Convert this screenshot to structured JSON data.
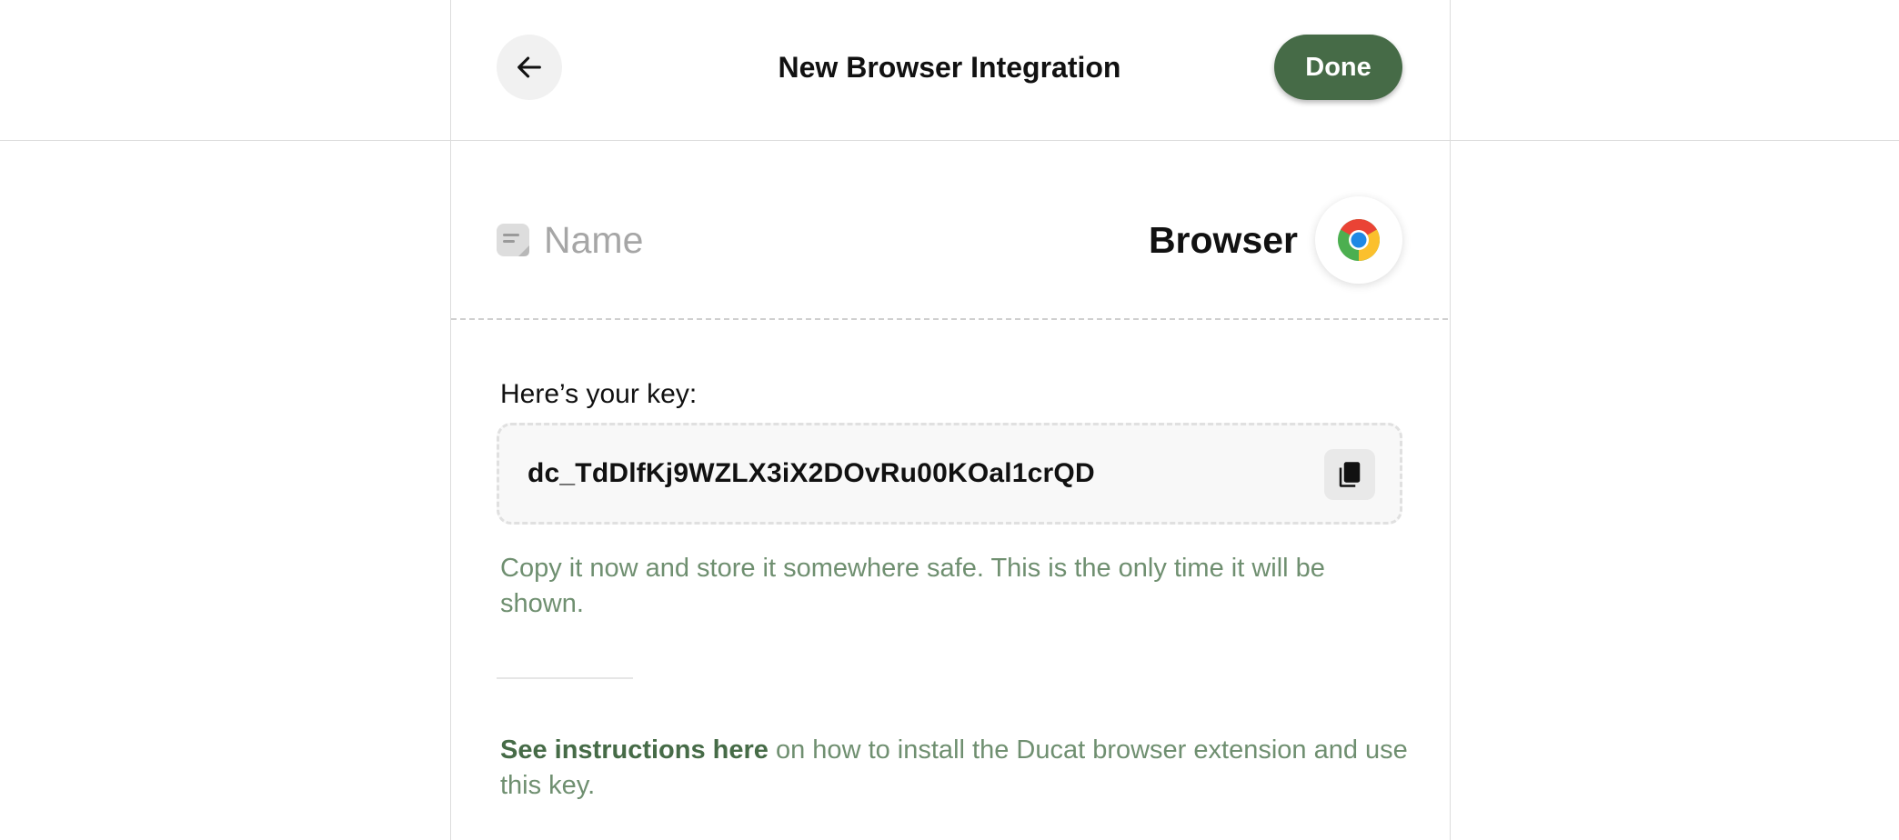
{
  "header": {
    "title": "New Browser Integration",
    "done_label": "Done",
    "back_icon": "arrow-left-icon"
  },
  "integration": {
    "name_placeholder": "Name",
    "name_value": "",
    "name_icon": "note-icon",
    "type_label": "Browser",
    "type_icon": "chrome-icon"
  },
  "key_section": {
    "label": "Here’s your key:",
    "key_value": "dc_TdDlfKj9WZLX3iX2DOvRu00KOal1crQD",
    "copy_icon": "copy-icon",
    "warning": "Copy it now and store it somewhere safe. This is the only time it will be shown."
  },
  "instructions": {
    "link_text": "See instructions here",
    "rest_text": " on how to install the Ducat browser extension and use this key."
  },
  "colors": {
    "accent": "#466b47",
    "muted_green": "#6f8f70"
  }
}
